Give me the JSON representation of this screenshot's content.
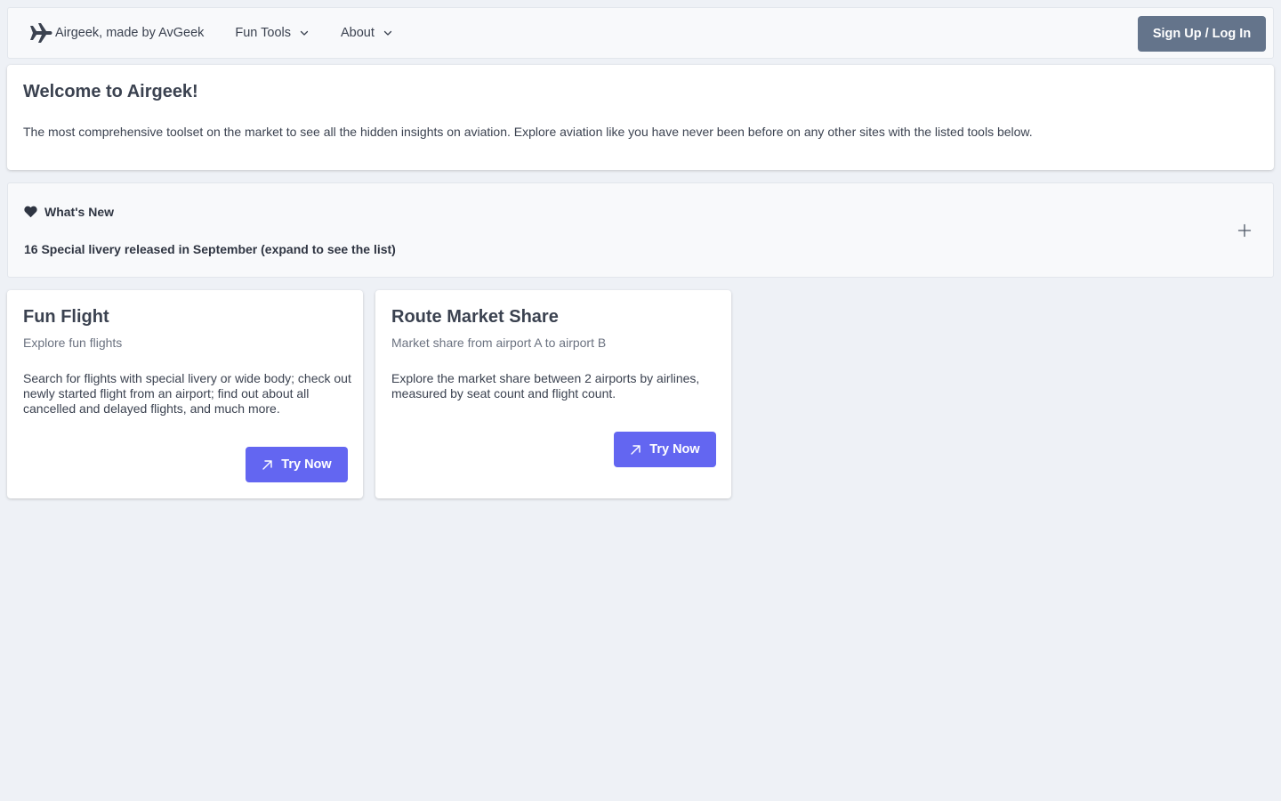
{
  "nav": {
    "brand_label": "Airgeek, made by AvGeek",
    "brand_icon": "airplane-icon",
    "menus": [
      {
        "label": "Fun Tools",
        "icon": "chevron-down-icon"
      },
      {
        "label": "About",
        "icon": "chevron-down-icon"
      }
    ],
    "signup_label": "Sign Up / Log In"
  },
  "welcome": {
    "title": "Welcome to Airgeek!",
    "text": "The most comprehensive toolset on the market to see all the hidden insights on aviation. Explore aviation like you have never been before on any other sites with the listed tools below."
  },
  "whats_new": {
    "title": "What's New",
    "icon": "heart-icon",
    "body": "16 Special livery released in September (expand to see the list)",
    "toggle_icon": "plus-icon"
  },
  "cards": [
    {
      "title": "Fun Flight",
      "subtitle": "Explore fun flights",
      "description": "Search for flights with special livery or wide body; check out newly started flight from an airport; find out about all cancelled and delayed flights, and much more.",
      "button_label": "Try Now",
      "button_icon": "arrow-up-right-icon"
    },
    {
      "title": "Route Market Share",
      "subtitle": "Market share from airport A to airport B",
      "description": "Explore the market share between 2 airports by airlines, measured by seat count and flight count.",
      "button_label": "Try Now",
      "button_icon": "arrow-up-right-icon"
    }
  ],
  "colors": {
    "page_bg": "#eef1f6",
    "signup_bg": "#64748b",
    "accent": "#6366f1",
    "text": "#3b4250"
  }
}
